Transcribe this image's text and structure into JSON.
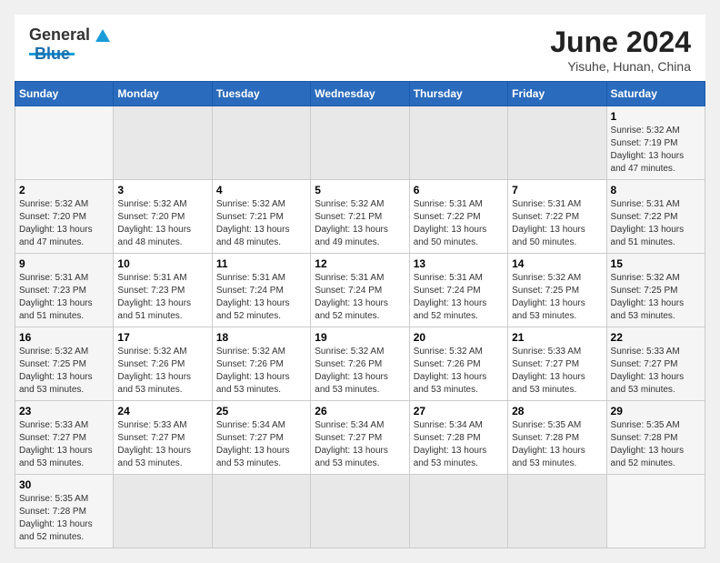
{
  "header": {
    "logo_general": "General",
    "logo_blue": "Blue",
    "title": "June 2024",
    "location": "Yisuhe, Hunan, China"
  },
  "days_of_week": [
    "Sunday",
    "Monday",
    "Tuesday",
    "Wednesday",
    "Thursday",
    "Friday",
    "Saturday"
  ],
  "weeks": [
    [
      {
        "day": "",
        "info": ""
      },
      {
        "day": "",
        "info": ""
      },
      {
        "day": "",
        "info": ""
      },
      {
        "day": "",
        "info": ""
      },
      {
        "day": "",
        "info": ""
      },
      {
        "day": "",
        "info": ""
      },
      {
        "day": "1",
        "info": "Sunrise: 5:32 AM\nSunset: 7:19 PM\nDaylight: 13 hours\nand 47 minutes."
      }
    ],
    [
      {
        "day": "2",
        "info": "Sunrise: 5:32 AM\nSunset: 7:20 PM\nDaylight: 13 hours\nand 47 minutes."
      },
      {
        "day": "3",
        "info": "Sunrise: 5:32 AM\nSunset: 7:20 PM\nDaylight: 13 hours\nand 48 minutes."
      },
      {
        "day": "4",
        "info": "Sunrise: 5:32 AM\nSunset: 7:21 PM\nDaylight: 13 hours\nand 48 minutes."
      },
      {
        "day": "5",
        "info": "Sunrise: 5:32 AM\nSunset: 7:21 PM\nDaylight: 13 hours\nand 49 minutes."
      },
      {
        "day": "6",
        "info": "Sunrise: 5:31 AM\nSunset: 7:22 PM\nDaylight: 13 hours\nand 50 minutes."
      },
      {
        "day": "7",
        "info": "Sunrise: 5:31 AM\nSunset: 7:22 PM\nDaylight: 13 hours\nand 50 minutes."
      },
      {
        "day": "8",
        "info": "Sunrise: 5:31 AM\nSunset: 7:22 PM\nDaylight: 13 hours\nand 51 minutes."
      }
    ],
    [
      {
        "day": "9",
        "info": "Sunrise: 5:31 AM\nSunset: 7:23 PM\nDaylight: 13 hours\nand 51 minutes."
      },
      {
        "day": "10",
        "info": "Sunrise: 5:31 AM\nSunset: 7:23 PM\nDaylight: 13 hours\nand 51 minutes."
      },
      {
        "day": "11",
        "info": "Sunrise: 5:31 AM\nSunset: 7:24 PM\nDaylight: 13 hours\nand 52 minutes."
      },
      {
        "day": "12",
        "info": "Sunrise: 5:31 AM\nSunset: 7:24 PM\nDaylight: 13 hours\nand 52 minutes."
      },
      {
        "day": "13",
        "info": "Sunrise: 5:31 AM\nSunset: 7:24 PM\nDaylight: 13 hours\nand 52 minutes."
      },
      {
        "day": "14",
        "info": "Sunrise: 5:32 AM\nSunset: 7:25 PM\nDaylight: 13 hours\nand 53 minutes."
      },
      {
        "day": "15",
        "info": "Sunrise: 5:32 AM\nSunset: 7:25 PM\nDaylight: 13 hours\nand 53 minutes."
      }
    ],
    [
      {
        "day": "16",
        "info": "Sunrise: 5:32 AM\nSunset: 7:25 PM\nDaylight: 13 hours\nand 53 minutes."
      },
      {
        "day": "17",
        "info": "Sunrise: 5:32 AM\nSunset: 7:26 PM\nDaylight: 13 hours\nand 53 minutes."
      },
      {
        "day": "18",
        "info": "Sunrise: 5:32 AM\nSunset: 7:26 PM\nDaylight: 13 hours\nand 53 minutes."
      },
      {
        "day": "19",
        "info": "Sunrise: 5:32 AM\nSunset: 7:26 PM\nDaylight: 13 hours\nand 53 minutes."
      },
      {
        "day": "20",
        "info": "Sunrise: 5:32 AM\nSunset: 7:26 PM\nDaylight: 13 hours\nand 53 minutes."
      },
      {
        "day": "21",
        "info": "Sunrise: 5:33 AM\nSunset: 7:27 PM\nDaylight: 13 hours\nand 53 minutes."
      },
      {
        "day": "22",
        "info": "Sunrise: 5:33 AM\nSunset: 7:27 PM\nDaylight: 13 hours\nand 53 minutes."
      }
    ],
    [
      {
        "day": "23",
        "info": "Sunrise: 5:33 AM\nSunset: 7:27 PM\nDaylight: 13 hours\nand 53 minutes."
      },
      {
        "day": "24",
        "info": "Sunrise: 5:33 AM\nSunset: 7:27 PM\nDaylight: 13 hours\nand 53 minutes."
      },
      {
        "day": "25",
        "info": "Sunrise: 5:34 AM\nSunset: 7:27 PM\nDaylight: 13 hours\nand 53 minutes."
      },
      {
        "day": "26",
        "info": "Sunrise: 5:34 AM\nSunset: 7:27 PM\nDaylight: 13 hours\nand 53 minutes."
      },
      {
        "day": "27",
        "info": "Sunrise: 5:34 AM\nSunset: 7:28 PM\nDaylight: 13 hours\nand 53 minutes."
      },
      {
        "day": "28",
        "info": "Sunrise: 5:35 AM\nSunset: 7:28 PM\nDaylight: 13 hours\nand 53 minutes."
      },
      {
        "day": "29",
        "info": "Sunrise: 5:35 AM\nSunset: 7:28 PM\nDaylight: 13 hours\nand 52 minutes."
      }
    ],
    [
      {
        "day": "30",
        "info": "Sunrise: 5:35 AM\nSunset: 7:28 PM\nDaylight: 13 hours\nand 52 minutes."
      },
      {
        "day": "",
        "info": ""
      },
      {
        "day": "",
        "info": ""
      },
      {
        "day": "",
        "info": ""
      },
      {
        "day": "",
        "info": ""
      },
      {
        "day": "",
        "info": ""
      },
      {
        "day": "",
        "info": ""
      }
    ]
  ]
}
